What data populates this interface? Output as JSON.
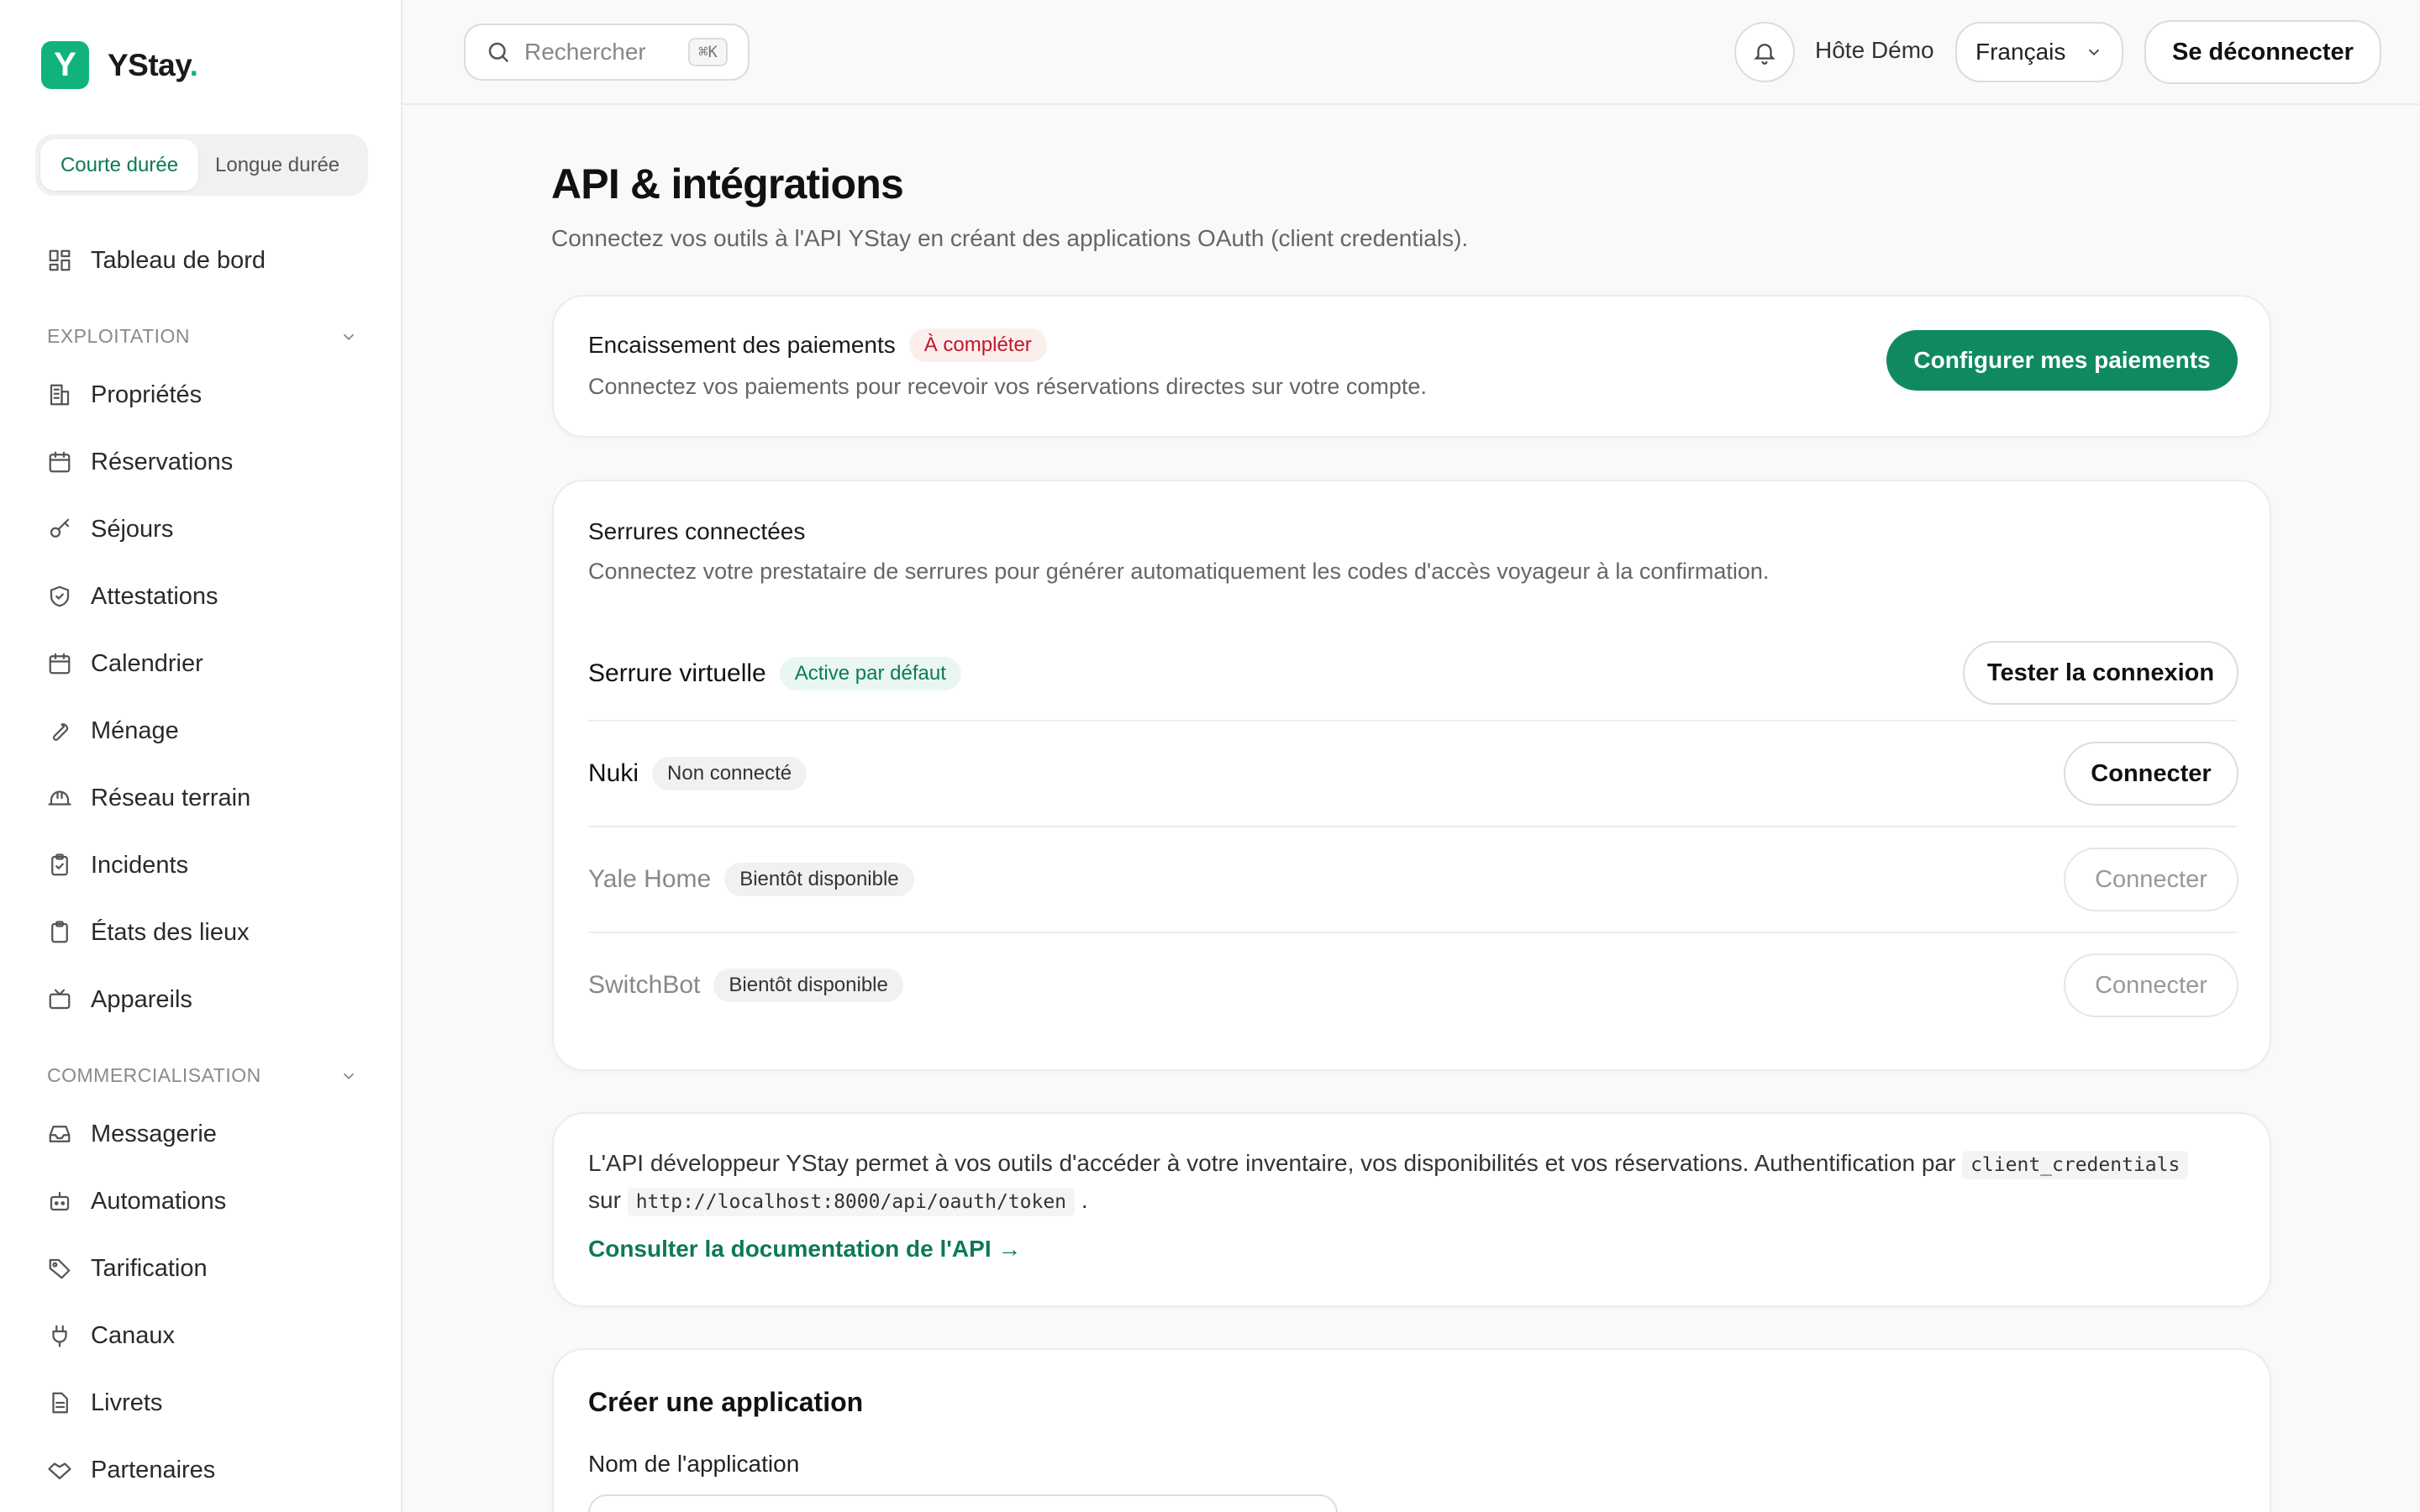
{
  "brand": {
    "logo_letter": "Y",
    "name": "YStay",
    "dot": ".",
    "accent": "#10b47a"
  },
  "mode_switch": {
    "short": "Courte durée",
    "long": "Longue durée"
  },
  "sidebar": {
    "dashboard": {
      "label": "Tableau de bord",
      "icon": "dashboard-icon"
    },
    "sections": [
      {
        "title": "EXPLOITATION",
        "items": [
          {
            "label": "Propriétés",
            "icon": "building-icon"
          },
          {
            "label": "Réservations",
            "icon": "calendar-icon"
          },
          {
            "label": "Séjours",
            "icon": "key-icon"
          },
          {
            "label": "Attestations",
            "icon": "shield-icon"
          },
          {
            "label": "Calendrier",
            "icon": "calendar-icon"
          },
          {
            "label": "Ménage",
            "icon": "wrench-icon"
          },
          {
            "label": "Réseau terrain",
            "icon": "helmet-icon"
          },
          {
            "label": "Incidents",
            "icon": "clipboard-check-icon"
          },
          {
            "label": "États des lieux",
            "icon": "clipboard-icon"
          },
          {
            "label": "Appareils",
            "icon": "tv-icon"
          }
        ]
      },
      {
        "title": "COMMERCIALISATION",
        "items": [
          {
            "label": "Messagerie",
            "icon": "inbox-icon"
          },
          {
            "label": "Automations",
            "icon": "bot-icon"
          },
          {
            "label": "Tarification",
            "icon": "tag-icon"
          },
          {
            "label": "Canaux",
            "icon": "plug-icon"
          },
          {
            "label": "Livrets",
            "icon": "document-icon"
          },
          {
            "label": "Partenaires",
            "icon": "handshake-icon"
          }
        ]
      }
    ]
  },
  "topbar": {
    "search_placeholder": "Rechercher",
    "search_shortcut": "⌘K",
    "host": "Hôte Démo",
    "language": "Français",
    "logout": "Se déconnecter"
  },
  "page": {
    "title": "API & intégrations",
    "subtitle": "Connectez vos outils à l'API YStay en créant des applications OAuth (client credentials)."
  },
  "payments": {
    "title": "Encaissement des paiements",
    "badge": "À compléter",
    "description": "Connectez vos paiements pour recevoir vos réservations directes sur votre compte.",
    "button": "Configurer mes paiements"
  },
  "locks": {
    "title": "Serrures connectées",
    "description": "Connectez votre prestataire de serrures pour générer automatiquement les codes d'accès voyageur à la confirmation.",
    "rows": [
      {
        "name": "Serrure virtuelle",
        "badge": "Active par défaut",
        "button": "Tester la connexion"
      },
      {
        "name": "Nuki",
        "badge": "Non connecté",
        "button": "Connecter"
      },
      {
        "name": "Yale Home",
        "badge": "Bientôt disponible",
        "button": "Connecter"
      },
      {
        "name": "SwitchBot",
        "badge": "Bientôt disponible",
        "button": "Connecter"
      }
    ]
  },
  "api": {
    "text_1": "L'API développeur YStay permet à vos outils d'accéder à votre inventaire, vos disponibilités et vos réservations. Authentification par",
    "code_1": "client_credentials",
    "text_2": "sur",
    "code_2": "http://localhost:8000/api/oauth/token",
    "text_3": ".",
    "link": "Consulter la documentation de l'API →"
  },
  "create_app": {
    "title": "Créer une application",
    "name_label": "Nom de l'application",
    "name_value": ""
  }
}
